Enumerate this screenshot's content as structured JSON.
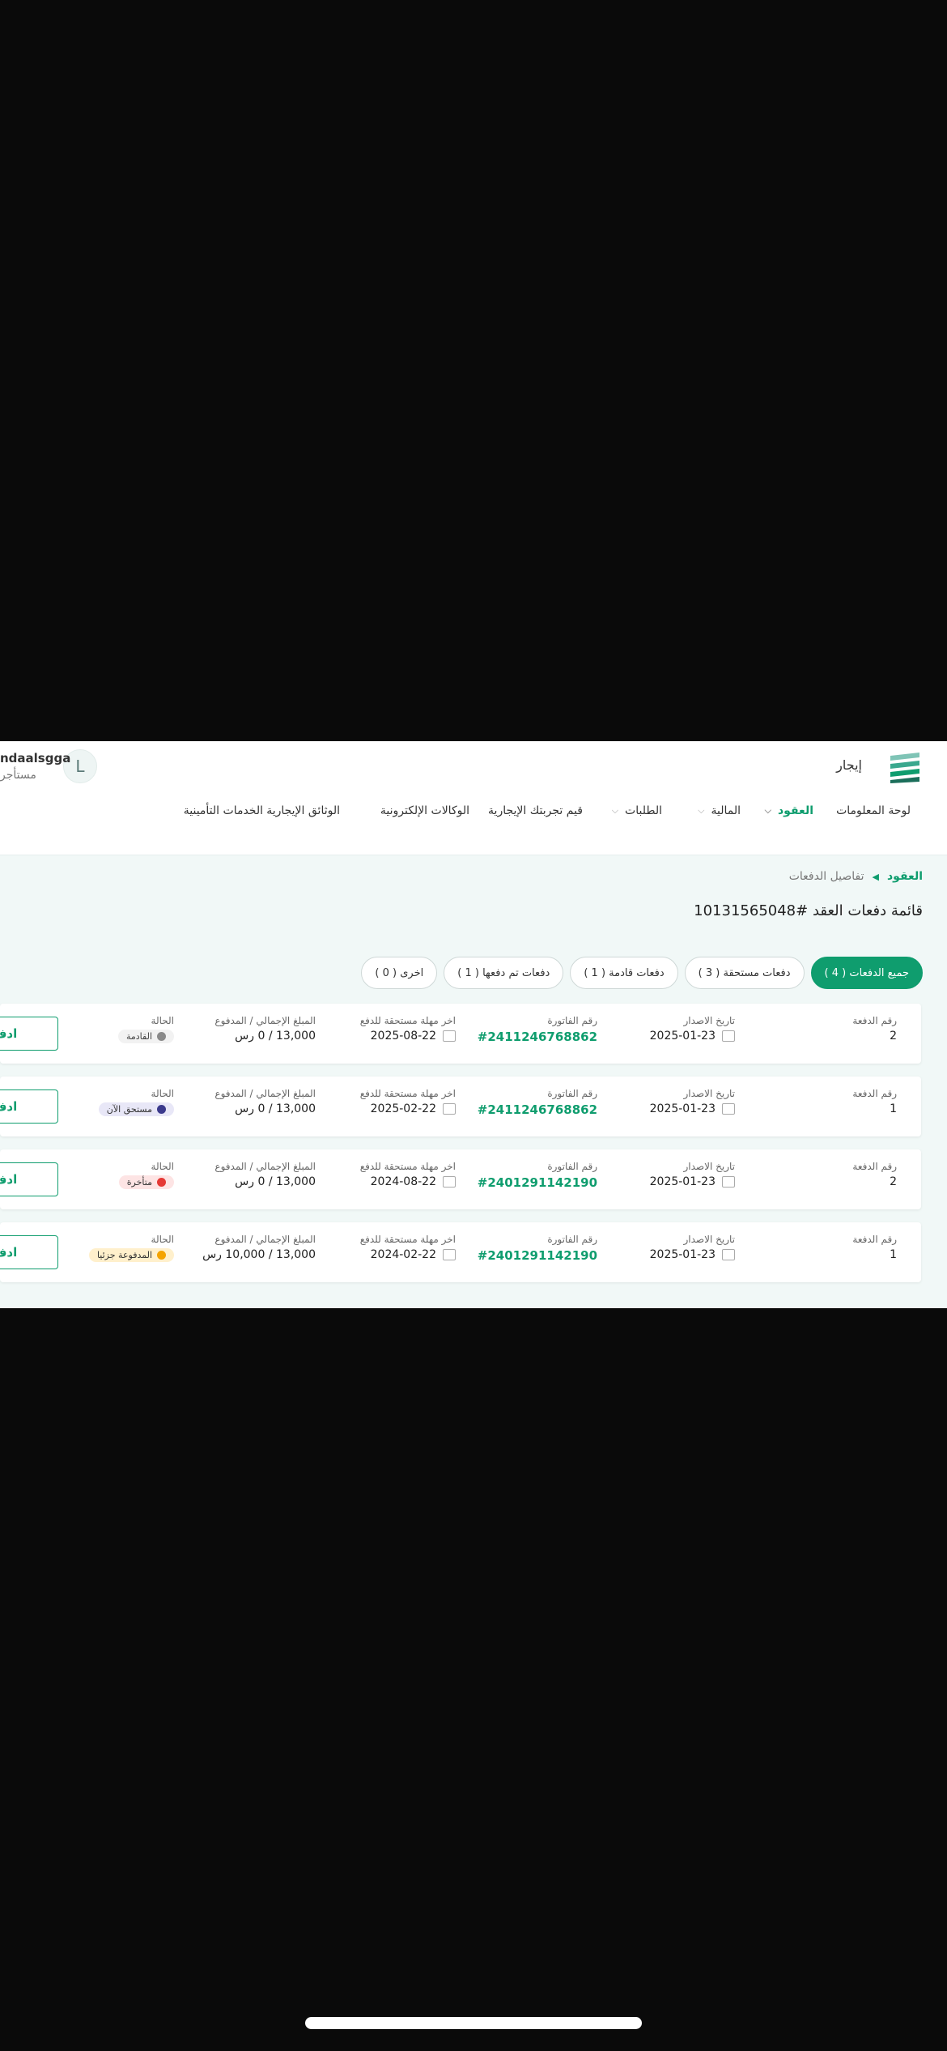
{
  "header": {
    "brand": "إيجار",
    "user_name": "ndaalsgga",
    "user_role": "مستأجر",
    "avatar_letter": "L"
  },
  "nav": [
    {
      "label": "لوحة المعلومات",
      "active": false,
      "dropdown": false
    },
    {
      "label": "العقود",
      "active": true,
      "dropdown": true
    },
    {
      "label": "المالية",
      "active": false,
      "dropdown": true
    },
    {
      "label": "الطلبات",
      "active": false,
      "dropdown": true
    },
    {
      "label": "قيم تجربتك الإيجارية",
      "active": false,
      "dropdown": false
    },
    {
      "label": "الوكالات الإلكترونية",
      "active": false,
      "dropdown": false
    },
    {
      "label": "الوثائق الإيجارية",
      "active": false,
      "dropdown": false
    },
    {
      "label": "الخدمات التأمينية",
      "active": false,
      "dropdown": false
    }
  ],
  "breadcrumb": {
    "root": "العقود",
    "current": "تفاصيل الدفعات"
  },
  "page_title": "قائمة دفعات العقد #10131565048",
  "tabs": [
    {
      "label": "جميع الدفعات ( 4 )",
      "active": true
    },
    {
      "label": "دفعات مستحقة ( 3 )",
      "active": false
    },
    {
      "label": "دفعات قادمة ( 1 )",
      "active": false
    },
    {
      "label": "دفعات تم دفعها ( 1 )",
      "active": false
    },
    {
      "label": "اخرى ( 0 )",
      "active": false
    }
  ],
  "columns": {
    "payment_no": "رقم الدفعة",
    "issue_date": "تاريخ الاصدار",
    "invoice_no": "رقم الفاتورة",
    "due_date": "اخر مهلة مستحقة للدفع",
    "amount": "المبلغ الإجمالي / المدفوع",
    "status": "الحالة"
  },
  "action_label": "ادف",
  "payments": [
    {
      "payment_no": "2",
      "issue_date": "2025-01-23",
      "invoice_no": "#2411246768862",
      "due_date": "2025-08-22",
      "amount": "13,000 / 0 رس",
      "status": "القادمة",
      "status_color": "#8a8a8a",
      "status_bg": "#f2f2f2"
    },
    {
      "payment_no": "1",
      "issue_date": "2025-01-23",
      "invoice_no": "#2411246768862",
      "due_date": "2025-02-22",
      "amount": "13,000 / 0 رس",
      "status": "مستحق الآن",
      "status_color": "#3b3a8c",
      "status_bg": "#e8e7f7"
    },
    {
      "payment_no": "2",
      "issue_date": "2025-01-23",
      "invoice_no": "#2401291142190",
      "due_date": "2024-08-22",
      "amount": "13,000 / 0 رس",
      "status": "متأخرة",
      "status_color": "#e53935",
      "status_bg": "#fde4e4"
    },
    {
      "payment_no": "1",
      "issue_date": "2025-01-23",
      "invoice_no": "#2401291142190",
      "due_date": "2024-02-22",
      "amount": "13,000 / 10,000 رس",
      "status": "المدفوعة جزئيا",
      "status_color": "#f4a300",
      "status_bg": "#fff0cc"
    }
  ]
}
